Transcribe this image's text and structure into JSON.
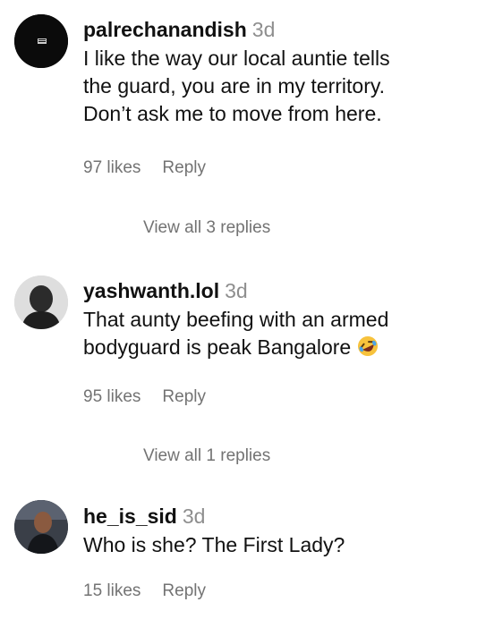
{
  "comments": [
    {
      "username": "palrechanandish",
      "age": "3d",
      "lines": [
        "I like the way our local auntie tells",
        "the guard, you are in my territory.",
        "Don’t ask me to move from here."
      ],
      "likes": "97 likes",
      "reply": "Reply",
      "view_replies": "View all 3 replies",
      "avatar_icon": "dark-logo-avatar"
    },
    {
      "username": "yashwanth.lol",
      "age": "3d",
      "lines": [
        "That aunty beefing with an armed",
        "bodyguard is peak Bangalore"
      ],
      "emoji": "rolling-on-floor-laughing-emoji",
      "likes": "95 likes",
      "reply": "Reply",
      "view_replies": "View all 1 replies",
      "avatar_icon": "portrait-avatar"
    },
    {
      "username": "he_is_sid",
      "age": "3d",
      "lines": [
        "Who is she? The First Lady?"
      ],
      "likes": "15 likes",
      "reply": "Reply",
      "avatar_icon": "portrait-avatar"
    }
  ]
}
